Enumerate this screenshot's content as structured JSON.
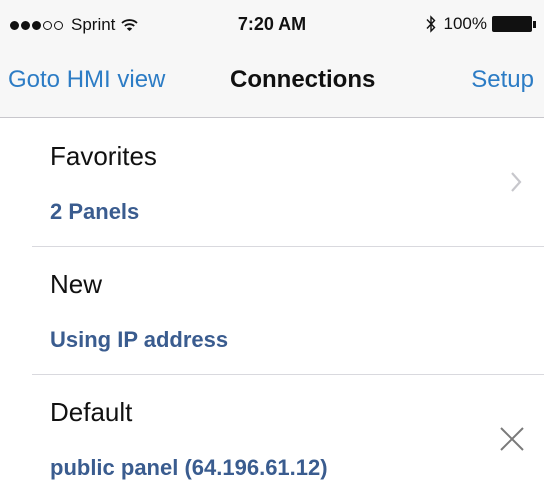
{
  "status_bar": {
    "carrier": "Sprint",
    "signal_bars_filled": 3,
    "signal_bars_total": 5,
    "time": "7:20 AM",
    "battery_percent": "100%",
    "icons": [
      "wifi-icon",
      "bluetooth-icon",
      "battery-icon"
    ]
  },
  "nav": {
    "left_label": "Goto HMI view",
    "title": "Connections",
    "right_label": "Setup"
  },
  "rows": [
    {
      "title": "Favorites",
      "subtitle": "2 Panels",
      "accessory": "chevron-right-icon"
    },
    {
      "title": "New",
      "subtitle": "Using IP address",
      "accessory": ""
    },
    {
      "title": "Default",
      "subtitle": "public panel (64.196.61.12)",
      "accessory": "close-icon"
    }
  ],
  "colors": {
    "accent": "#2c7cc5",
    "subtitle": "#3a5c8f",
    "separator": "#d9d9de",
    "bar_background": "#f7f7f7"
  }
}
